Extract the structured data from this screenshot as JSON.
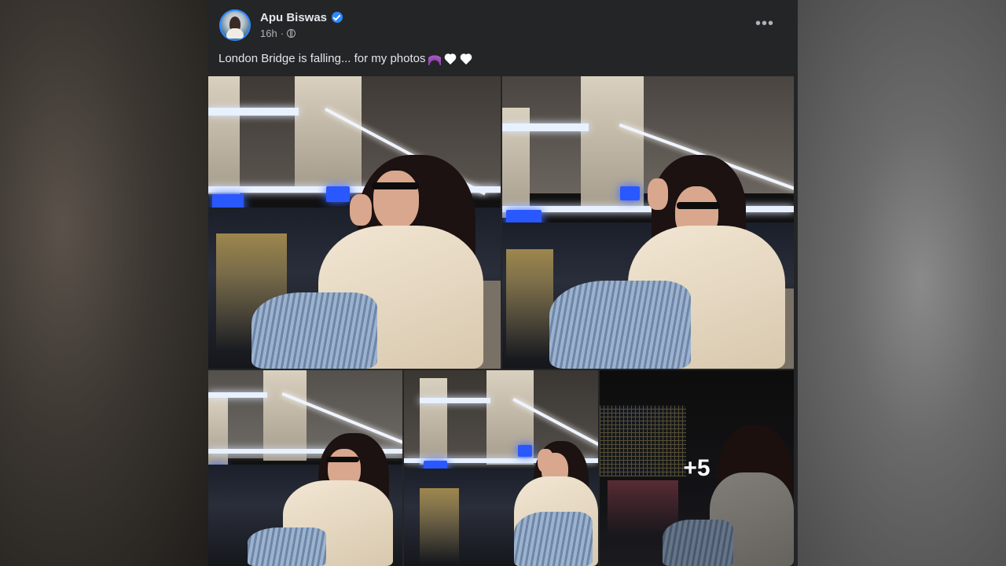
{
  "post": {
    "author": "Apu Biswas",
    "verified": true,
    "time": "16h",
    "audience_icon": "globe-icon",
    "more_icon": "more-options-icon",
    "more_label": "•••",
    "caption": "London Bridge is falling... for my photos",
    "caption_emojis": [
      "umbrella-rain-emoji",
      "white-heart-emoji",
      "white-heart-emoji"
    ]
  },
  "gallery": {
    "photo_count_visible": 5,
    "more_count_label": "+5"
  },
  "colors": {
    "card_bg": "#242526",
    "text_primary": "#e4e6eb",
    "text_secondary": "#b0b3b8",
    "verified_blue": "#2d88ff"
  }
}
